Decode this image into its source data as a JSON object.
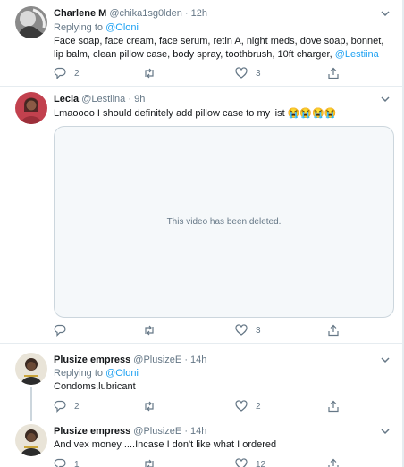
{
  "tweets": [
    {
      "name": "Charlene M",
      "handle": "@chika1sg0lden",
      "dot": "·",
      "time": "12h",
      "replying_prefix": "Replying to ",
      "replying_to": "@Oloni",
      "text_line1": "Face soap, face cream, face serum, retin A, night meds, dove soap, bonnet,",
      "text_line2": "lip balm, clean pillow case, body spray, toothbrush, 10ft charger, ",
      "text_mention": "@Lestiina",
      "replies": "2",
      "retweets": "",
      "likes": "3"
    },
    {
      "name": "Lecia",
      "handle": "@Lestiina",
      "dot": "·",
      "time": "9h",
      "text": "Lmaoooo I should definitely add pillow case to my list 😭😭😭😭",
      "video_message": "This video has been deleted.",
      "replies": "",
      "retweets": "",
      "likes": "3"
    },
    {
      "name": "Plusize empress",
      "handle": "@PlusizeE",
      "dot": "·",
      "time": "14h",
      "replying_prefix": "Replying to ",
      "replying_to": "@Oloni",
      "text": "Condoms,lubricant",
      "replies": "2",
      "retweets": "",
      "likes": "2"
    },
    {
      "name": "Plusize empress",
      "handle": "@PlusizeE",
      "dot": "·",
      "time": "14h",
      "text": "And vex money ....Incase I don't like what I ordered",
      "replies": "1",
      "retweets": "",
      "likes": "12"
    }
  ],
  "colors": {
    "accent": "#1da1f2",
    "muted": "#657786",
    "divider": "#e6ecf0"
  },
  "icons": [
    "reply-icon",
    "retweet-icon",
    "like-icon",
    "share-icon",
    "chevron-down-icon"
  ]
}
